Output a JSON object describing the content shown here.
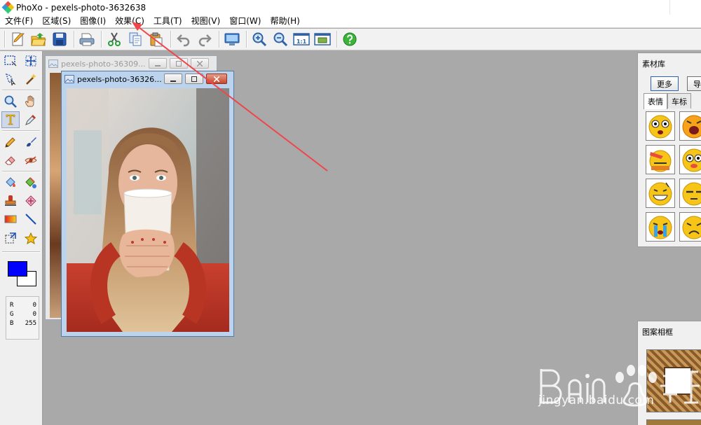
{
  "window": {
    "title": "PhoXo - pexels-photo-3632638"
  },
  "menu": {
    "items": [
      {
        "label": "文件(F)"
      },
      {
        "label": "区域(S)"
      },
      {
        "label": "图像(I)"
      },
      {
        "label": "效果(C)"
      },
      {
        "label": "工具(T)"
      },
      {
        "label": "视图(V)"
      },
      {
        "label": "窗口(W)"
      },
      {
        "label": "帮助(H)"
      }
    ]
  },
  "toolbar": {
    "buttons": [
      "new-file-icon",
      "open-folder-icon",
      "save-icon",
      "print-icon",
      "cut-icon",
      "copy-icon",
      "paste-icon",
      "undo-icon",
      "redo-icon",
      "screen-capture-icon",
      "zoom-in-icon",
      "zoom-out-icon",
      "actual-size-icon",
      "fit-window-icon",
      "help-icon"
    ],
    "actual_size_label": "1:1"
  },
  "tools": {
    "icons": [
      "rect-select-icon",
      "move-icon",
      "lasso-icon",
      "magic-wand-icon",
      "zoom-icon",
      "hand-icon",
      "text-icon",
      "eyedropper-icon",
      "pencil-icon",
      "brush-icon",
      "eraser-icon",
      "smudge-icon",
      "fill-icon",
      "color-replace-icon",
      "stamp-icon",
      "heal-icon",
      "gradient-icon",
      "line-icon",
      "transform-icon",
      "star-shape-icon"
    ],
    "active": "text-icon",
    "foreground_color": "#0000ff",
    "background_color": "#ffffff"
  },
  "color_readout": {
    "r_label": "R",
    "r_value": "0",
    "g_label": "G",
    "g_value": "0",
    "b_label": "B",
    "b_value": "255"
  },
  "documents": {
    "back_title": "pexels-photo-36309...",
    "front_title": "pexels-photo-36326..."
  },
  "materials_panel": {
    "title": "素材库",
    "more_button": "更多",
    "import_button": "导",
    "tabs": [
      "表情",
      "车标"
    ]
  },
  "frames_panel": {
    "title": "图案相框"
  },
  "watermark": {
    "text": "jingyan.baidu.com"
  },
  "colors": {
    "annotation_arrow": "#f0454a",
    "workspace": "#a9a9a9"
  }
}
